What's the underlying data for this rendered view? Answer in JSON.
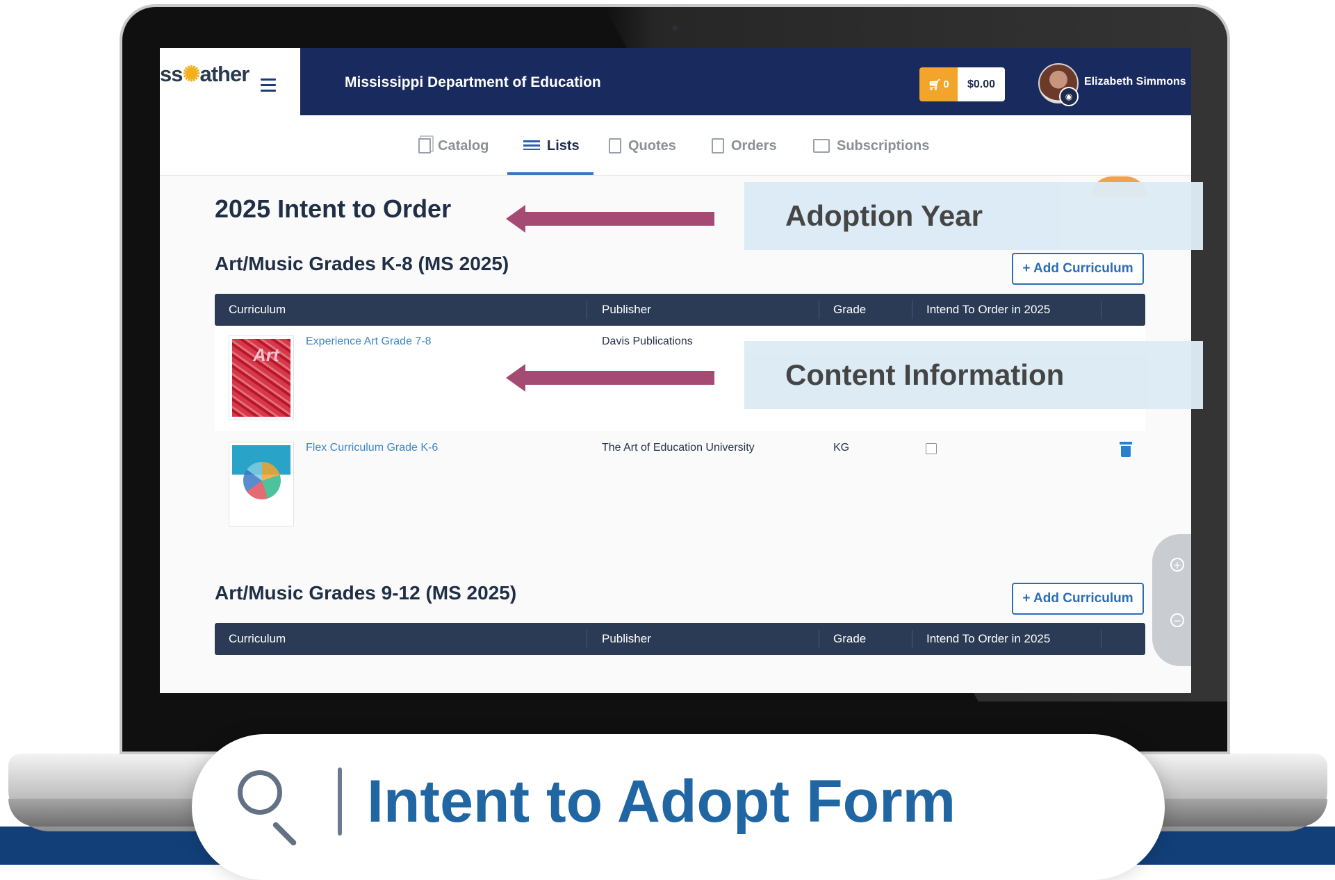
{
  "app": {
    "logo_text_prefix": "ss",
    "logo_text_suffix": "ather",
    "org_name": "Mississippi Department of Education",
    "cart_count": "0",
    "cart_total": "$0.00",
    "user_name": "Elizabeth Simmons"
  },
  "tabs": [
    {
      "label": "Catalog",
      "icon": "catalog-icon"
    },
    {
      "label": "Lists",
      "icon": "list-icon",
      "active": true
    },
    {
      "label": "Quotes",
      "icon": "quote-document-icon"
    },
    {
      "label": "Orders",
      "icon": "orders-icon"
    },
    {
      "label": "Subscriptions",
      "icon": "subscriptions-icon"
    }
  ],
  "page": {
    "title": "2025 Intent to Order"
  },
  "table_headers": {
    "curriculum": "Curriculum",
    "publisher": "Publisher",
    "grade": "Grade",
    "intend": "Intend To Order in 2025"
  },
  "sections": [
    {
      "title": "Art/Music Grades K-8 (MS 2025)",
      "add_label": "+ Add Curriculum",
      "rows": [
        {
          "curriculum": "Experience Art Grade 7-8",
          "publisher": "Davis Publications",
          "grade": "",
          "cover_text": "Art"
        },
        {
          "curriculum": "Flex Curriculum Grade K-6",
          "publisher": "The Art of Education University",
          "grade": "KG",
          "checked": false
        }
      ]
    },
    {
      "title": "Art/Music Grades 9-12 (MS 2025)",
      "add_label": "+ Add Curriculum",
      "rows": []
    }
  ],
  "callouts": {
    "adoption_year": "Adoption Year",
    "content_information": "Content Information"
  },
  "banner": {
    "text": "Intent to Adopt Form",
    "icon": "search-icon"
  },
  "colors": {
    "topbar": "#192b5e",
    "accent": "#f2a52a",
    "link": "#3d86c6",
    "callout_bg": "#dcebf5",
    "arrow": "#a44a73",
    "banner_text": "#1f66a3"
  }
}
